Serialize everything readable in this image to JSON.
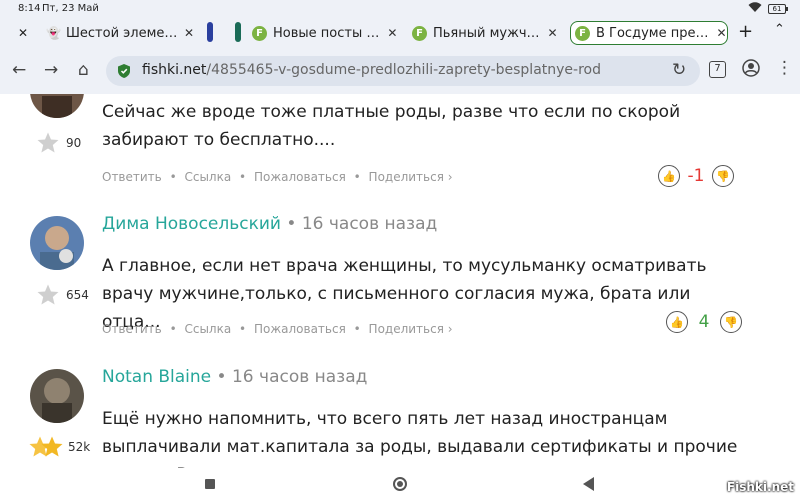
{
  "status_bar": {
    "time": "8:14",
    "date": "Пт, 23 Май",
    "battery": "61"
  },
  "tabs": [
    {
      "label": "Шестой элеме…",
      "icon": "ghost-icon"
    },
    {
      "label": "Новые посты …",
      "icon": "fishki-favicon"
    },
    {
      "label": "Пьяный мужч…",
      "icon": "fishki-favicon"
    },
    {
      "label": "В Госдуме пре…",
      "icon": "fishki-favicon",
      "active": true
    }
  ],
  "toolbar": {
    "url_domain": "fishki.net",
    "url_path": "/4855465-v-gosdume-predlozhili-zaprety-besplatnye-rod",
    "tab_count": "7"
  },
  "comments": [
    {
      "author": "",
      "time": "",
      "rating": "90",
      "text": "Сейчас же вроде тоже платные роды, разве что если по скорой забирают то бесплатно....",
      "score": "-1",
      "star": "grey-star-icon"
    },
    {
      "author": "Дима Новосельский",
      "time": "16 часов назад",
      "rating": "654",
      "text": "А главное, если нет врача женщины, то мусульманку осматривать врачу мужчине,только, с письменного согласия мужа, брата или отца...",
      "score": "4",
      "star": "grey-star-icon"
    },
    {
      "author": "Notan Blaine",
      "time": "16 часов назад",
      "rating": "52k",
      "text": "Ещё нужно напомнить, что всего пять лет назад иностранцам выплачивали мат.капитала за роды, выдавали сертификаты и прочие льготы. В итоге в",
      "star": "gold-stars-icon"
    }
  ],
  "actions": {
    "reply": "Ответить",
    "link": "Ссылка",
    "complain": "Пожаловаться",
    "share": "Поделиться ›",
    "sep": "•"
  },
  "watermark": "Fishki.net",
  "colors": {
    "author": "#26a69a",
    "negative": "#e53935",
    "positive": "#43a047",
    "accent": "#2e7d32"
  }
}
